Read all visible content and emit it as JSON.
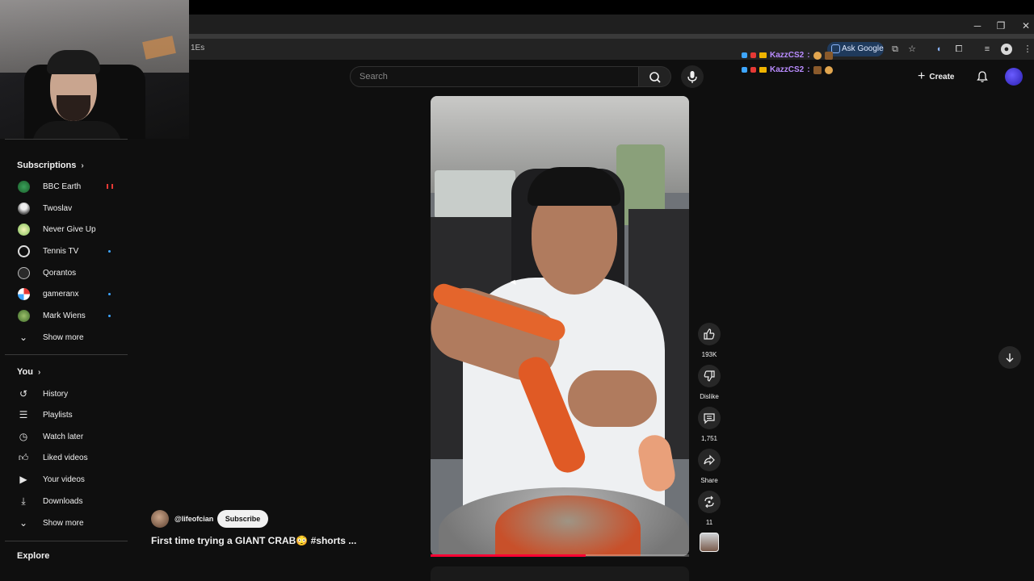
{
  "browser": {
    "url_fragment": "1Es",
    "ask_google_label": "Ask Google",
    "window_controls": {
      "minimize": "─",
      "restore": "❐",
      "close": "✕"
    }
  },
  "chat_overlay": [
    {
      "user": "KazzCS2",
      "sep": ":"
    },
    {
      "user": "KazzCS2",
      "sep": ":"
    }
  ],
  "header": {
    "search_placeholder": "Search",
    "create_label": "Create"
  },
  "sidebar": {
    "subscriptions_heading": "Subscriptions",
    "subscriptions": [
      {
        "label": "BBC Earth",
        "status": "live"
      },
      {
        "label": "Twoslav",
        "status": ""
      },
      {
        "label": "Never Give Up",
        "status": ""
      },
      {
        "label": "Tennis TV",
        "status": "new"
      },
      {
        "label": "Qorantos",
        "status": ""
      },
      {
        "label": "gameranx",
        "status": "new"
      },
      {
        "label": "Mark Wiens",
        "status": "new"
      }
    ],
    "subs_show_more": "Show more",
    "you_heading": "You",
    "you_items": [
      {
        "label": "History",
        "icon": "history-icon"
      },
      {
        "label": "Playlists",
        "icon": "playlists-icon"
      },
      {
        "label": "Watch later",
        "icon": "watch-later-icon"
      },
      {
        "label": "Liked videos",
        "icon": "liked-videos-icon"
      },
      {
        "label": "Your videos",
        "icon": "your-videos-icon"
      },
      {
        "label": "Downloads",
        "icon": "downloads-icon"
      }
    ],
    "you_show_more": "Show more",
    "explore_heading": "Explore"
  },
  "short": {
    "channel_handle": "@lifeofcian",
    "subscribe_label": "Subscribe",
    "title": "First time trying a GIANT CRAB😳 #shorts ...",
    "progress": 0.6
  },
  "actions": {
    "like_count": "193K",
    "dislike_label": "Dislike",
    "comment_count": "1,751",
    "share_label": "Share",
    "remix_count": "11"
  },
  "colors": {
    "background": "#0f0f0f",
    "accent_red": "#ff0033",
    "chat_name": "#b98cff",
    "new_dot": "#3ea6ff"
  }
}
